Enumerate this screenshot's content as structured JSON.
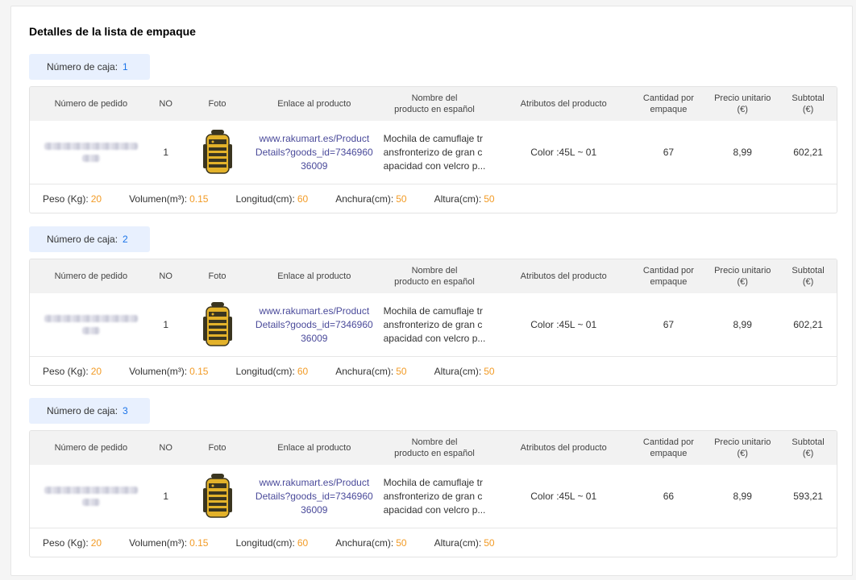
{
  "title": "Detalles de la lista de empaque",
  "box_label_prefix": "Número de caja:",
  "headers": {
    "order": "Número de pedido",
    "no": "NO",
    "photo": "Foto",
    "link": "Enlace al producto",
    "name_line1": "Nombre del",
    "name_line2": "producto en español",
    "attrs": "Atributos del producto",
    "qty_line1": "Cantidad por",
    "qty_line2": "empaque",
    "price_line1": "Precio unitario",
    "price_line2": "(€)",
    "subtotal_line1": "Subtotal",
    "subtotal_line2": "(€)"
  },
  "footer_labels": {
    "weight": "Peso (Kg):",
    "volume": "Volumen(m³):",
    "length": "Longitud(cm):",
    "width": "Anchura(cm):",
    "height": "Altura(cm):"
  },
  "colors": {
    "accent": "#1a73e8",
    "value": "#f29b26",
    "link": "#4a4a9a"
  },
  "boxes": [
    {
      "number": "1",
      "row": {
        "no": "1",
        "photo_icon": "backpack-icon",
        "link_l1": "www.rakumart.es/Product",
        "link_l2": "Details?goods_id=7346960",
        "link_l3": "36009",
        "name_l1": "Mochila de camuflaje tr",
        "name_l2": "ansfronterizo de gran c",
        "name_l3": "apacidad con velcro p...",
        "attrs": "Color :45L ~ 01",
        "qty": "67",
        "price": "8,99",
        "subtotal": "602,21"
      },
      "footer": {
        "weight": "20",
        "volume": "0.15",
        "length": "60",
        "width": "50",
        "height": "50"
      }
    },
    {
      "number": "2",
      "row": {
        "no": "1",
        "photo_icon": "backpack-icon",
        "link_l1": "www.rakumart.es/Product",
        "link_l2": "Details?goods_id=7346960",
        "link_l3": "36009",
        "name_l1": "Mochila de camuflaje tr",
        "name_l2": "ansfronterizo de gran c",
        "name_l3": "apacidad con velcro p...",
        "attrs": "Color :45L ~ 01",
        "qty": "67",
        "price": "8,99",
        "subtotal": "602,21"
      },
      "footer": {
        "weight": "20",
        "volume": "0.15",
        "length": "60",
        "width": "50",
        "height": "50"
      }
    },
    {
      "number": "3",
      "row": {
        "no": "1",
        "photo_icon": "backpack-icon",
        "link_l1": "www.rakumart.es/Product",
        "link_l2": "Details?goods_id=7346960",
        "link_l3": "36009",
        "name_l1": "Mochila de camuflaje tr",
        "name_l2": "ansfronterizo de gran c",
        "name_l3": "apacidad con velcro p...",
        "attrs": "Color :45L ~ 01",
        "qty": "66",
        "price": "8,99",
        "subtotal": "593,21"
      },
      "footer": {
        "weight": "20",
        "volume": "0.15",
        "length": "60",
        "width": "50",
        "height": "50"
      }
    }
  ]
}
